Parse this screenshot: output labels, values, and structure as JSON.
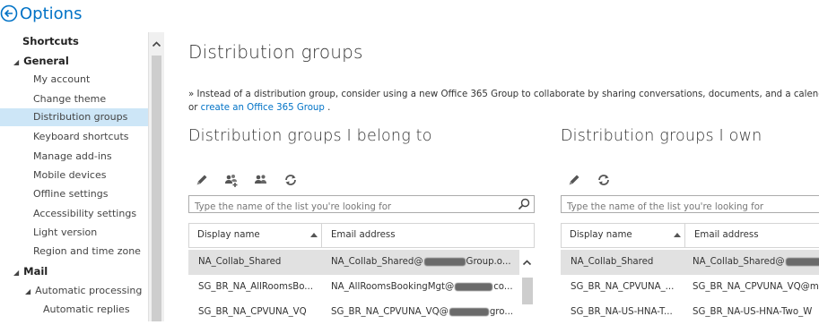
{
  "header": {
    "title": "Options",
    "back_icon": "back-arrow-circle-icon"
  },
  "sidebar": {
    "items": [
      {
        "label": "Shortcuts",
        "level": "top",
        "expander": ""
      },
      {
        "label": "General",
        "level": "top",
        "expander": "◢"
      },
      {
        "label": "My account",
        "level": "child"
      },
      {
        "label": "Change theme",
        "level": "child"
      },
      {
        "label": "Distribution groups",
        "level": "child",
        "selected": true
      },
      {
        "label": "Keyboard shortcuts",
        "level": "child"
      },
      {
        "label": "Manage add-ins",
        "level": "child"
      },
      {
        "label": "Mobile devices",
        "level": "child"
      },
      {
        "label": "Offline settings",
        "level": "child"
      },
      {
        "label": "Accessibility settings",
        "level": "child"
      },
      {
        "label": "Light version",
        "level": "child"
      },
      {
        "label": "Region and time zone",
        "level": "child"
      },
      {
        "label": "Mail",
        "level": "top",
        "expander": "◢"
      },
      {
        "label": "Automatic processing",
        "level": "child",
        "expander": "◢"
      },
      {
        "label": "Automatic replies",
        "level": "grandchild"
      }
    ]
  },
  "main": {
    "title": "Distribution groups",
    "info_text": "» Instead of a distribution group, consider using a new Office 365 Group to collaborate by sharing conversations, documents, and a calendar",
    "info_or": "or",
    "info_link": "create an Office 365 Group",
    "info_end": ".",
    "belong": {
      "title": "Distribution groups I belong to",
      "search_placeholder": "Type the name of the list you're looking for",
      "columns": [
        "Display name",
        "Email address"
      ],
      "rows": [
        {
          "name": "NA_Collab_Shared",
          "email_a": "NA_Collab_Shared@",
          "email_b": "Group.o..."
        },
        {
          "name": "SG_BR_NA_AllRoomsBo...",
          "email_a": "NA_AllRoomsBookingMgt@",
          "email_b": "co..."
        },
        {
          "name": "SG_BR_NA_CPVUNA_VQ",
          "email_a": "SG_BR_NA_CPVUNA_VQ@",
          "email_b": "gro..."
        }
      ]
    },
    "own": {
      "title": "Distribution groups I own",
      "search_placeholder": "Type the name of the list you're looking for",
      "columns": [
        "Display name",
        "Email address"
      ],
      "rows": [
        {
          "name": "NA_Collab_Shared",
          "email_a": "NA_Collab_Shared@"
        },
        {
          "name": "SG_BR_NA_CPVUNA_...",
          "email_a": "SG_BR_NA_CPVUNA_VQ@m"
        },
        {
          "name": "SG_BR_NA-US-HNA-T...",
          "email_a": "SG_BR_NA-US-HNA-Two_W"
        }
      ]
    }
  },
  "colors": {
    "accent": "#0072c6",
    "selected_nav": "#cde6f7",
    "selected_row": "#e1e1e1"
  }
}
